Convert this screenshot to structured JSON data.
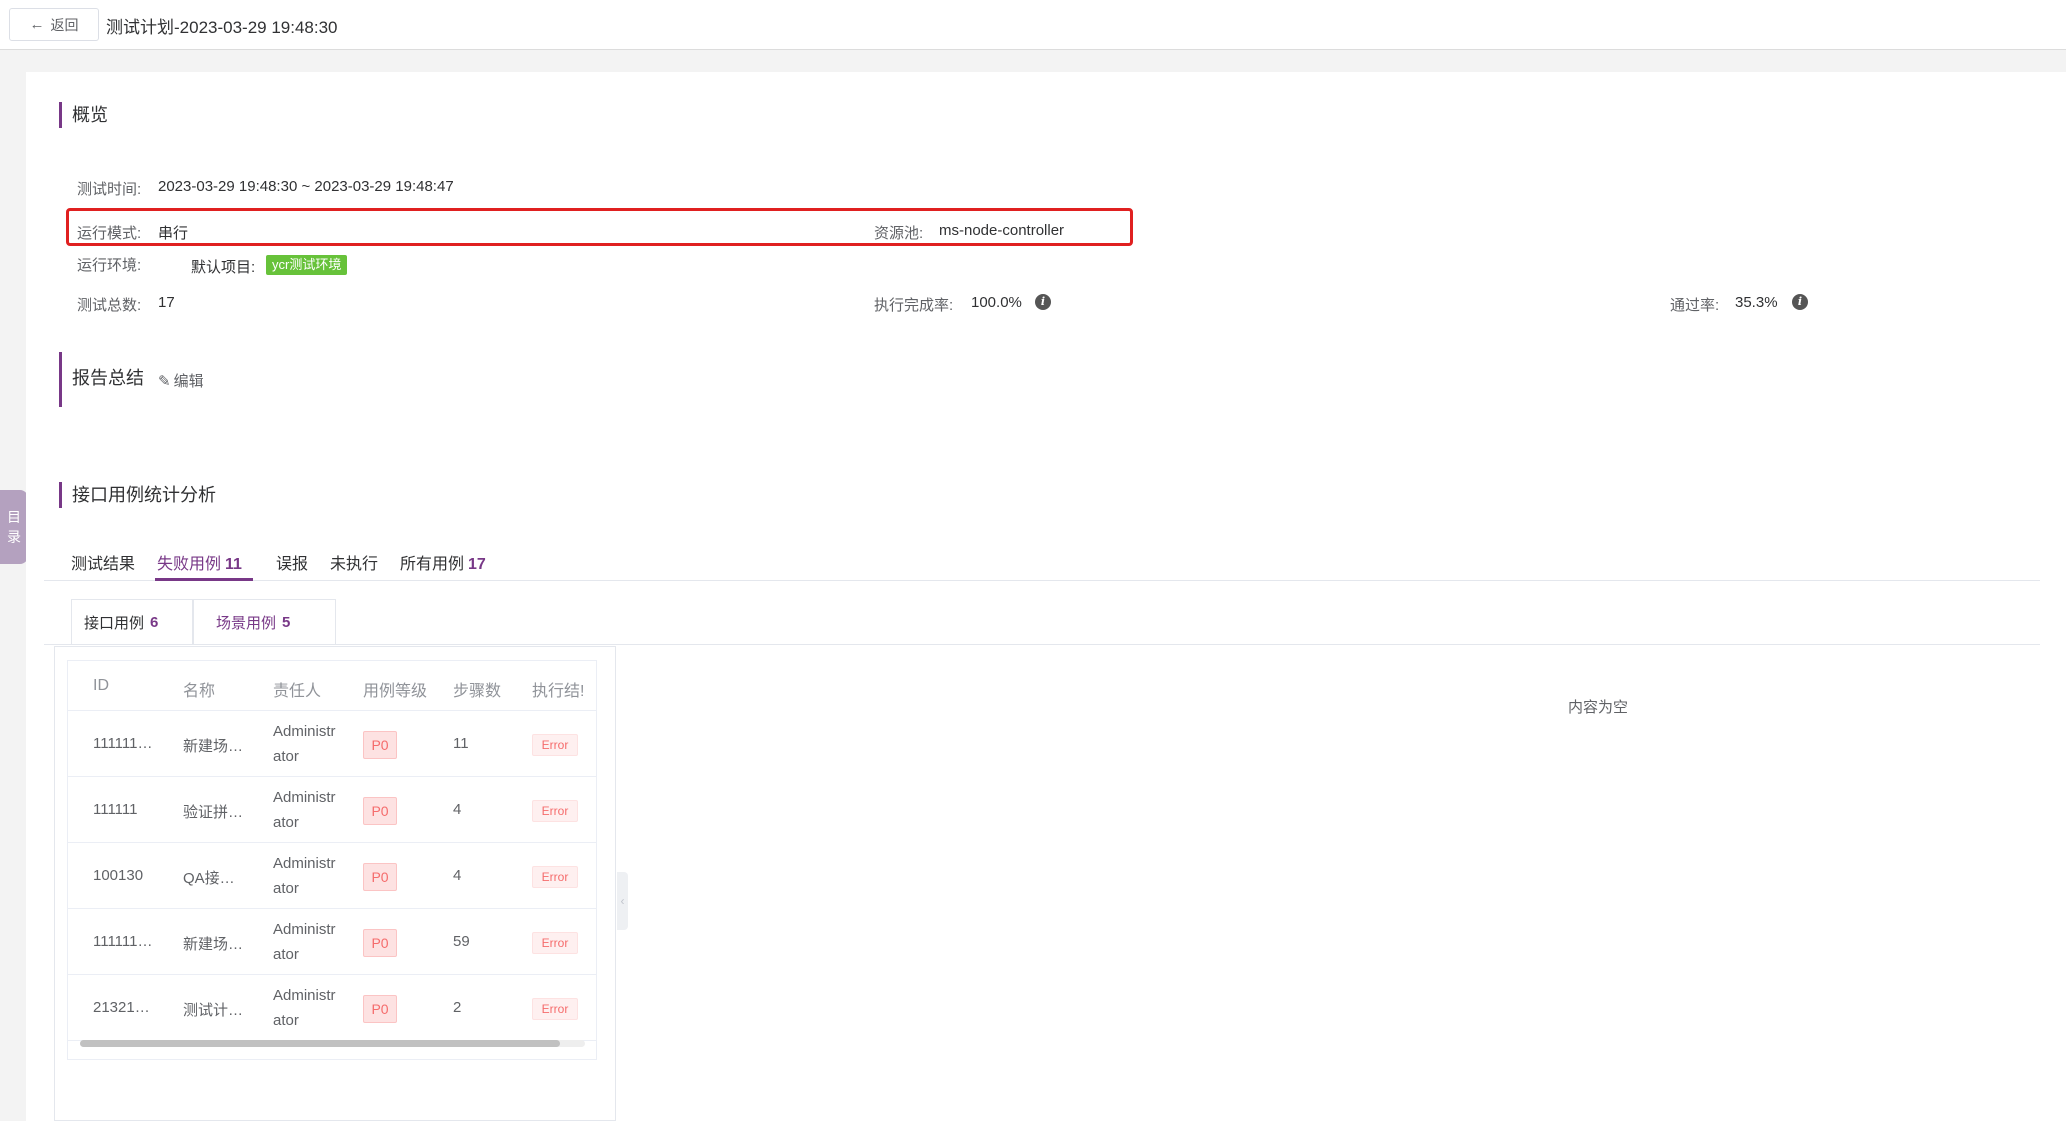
{
  "header": {
    "back_label": "返回",
    "title": "测试计划-2023-03-29 19:48:30"
  },
  "overview": {
    "title": "概览",
    "test_time_label": "测试时间:",
    "test_time_value": "2023-03-29 19:48:30 ~ 2023-03-29 19:48:47",
    "run_mode_label": "运行模式:",
    "run_mode_value": "串行",
    "resource_pool_label": "资源池:",
    "resource_pool_value": "ms-node-controller",
    "run_env_label": "运行环境:",
    "default_project_label": "默认项目:",
    "env_tag": "ycr测试环境",
    "total_label": "测试总数:",
    "total_value": "17",
    "exec_rate_label": "执行完成率:",
    "exec_rate_value": "100.0%",
    "pass_rate_label": "通过率:",
    "pass_rate_value": "35.3%"
  },
  "summary": {
    "title": "报告总结",
    "edit_label": "编辑"
  },
  "analysis": {
    "title": "接口用例统计分析",
    "tabs": [
      {
        "label": "测试结果",
        "count": ""
      },
      {
        "label": "失败用例",
        "count": "11"
      },
      {
        "label": "误报",
        "count": ""
      },
      {
        "label": "未执行",
        "count": ""
      },
      {
        "label": "所有用例",
        "count": "17"
      }
    ],
    "subtabs": [
      {
        "label": "接口用例",
        "count": "6"
      },
      {
        "label": "场景用例",
        "count": "5"
      }
    ],
    "table": {
      "headers": [
        "ID",
        "名称",
        "责任人",
        "用例等级",
        "步骤数",
        "执行结!"
      ],
      "rows": [
        {
          "id": "111111…",
          "name": "新建场…",
          "owner1": "Administr",
          "owner2": "ator",
          "level": "P0",
          "steps": "11",
          "status": "Error"
        },
        {
          "id": "111111",
          "name": "验证拼…",
          "owner1": "Administr",
          "owner2": "ator",
          "level": "P0",
          "steps": "4",
          "status": "Error"
        },
        {
          "id": "100130",
          "name": "QA接…",
          "owner1": "Administr",
          "owner2": "ator",
          "level": "P0",
          "steps": "4",
          "status": "Error"
        },
        {
          "id": "111111…",
          "name": "新建场…",
          "owner1": "Administr",
          "owner2": "ator",
          "level": "P0",
          "steps": "59",
          "status": "Error"
        },
        {
          "id": "21321…",
          "name": "测试计…",
          "owner1": "Administr",
          "owner2": "ator",
          "level": "P0",
          "steps": "2",
          "status": "Error"
        }
      ]
    },
    "empty_text": "内容为空"
  },
  "side_tab": {
    "char1": "目",
    "char2": "录"
  },
  "colors": {
    "accent": "#783887",
    "highlight": "#e02020",
    "env_tag": "#67c23a",
    "error": "#f56c6c"
  }
}
